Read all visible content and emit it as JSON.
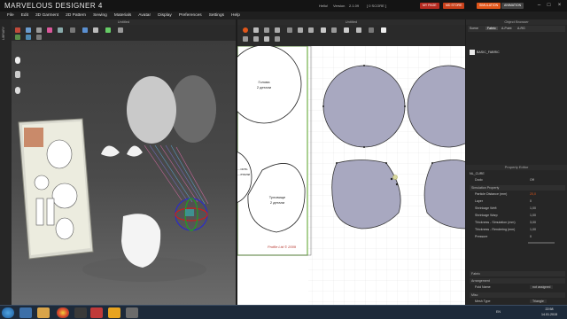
{
  "app": {
    "title": "MARVELOUS DESIGNER 4"
  },
  "titlebar": {
    "user": "Hello!",
    "version_label": "Version",
    "version": "2.1.09",
    "score_label": "[ 0 SCORE ]",
    "btn_my_page": "MY PAGE",
    "btn_md_store": "MD STORE",
    "btn_simulation": "SIMULATION",
    "btn_animation": "ANIMATION"
  },
  "menu": [
    "File",
    "Edit",
    "3D Garment",
    "2D Pattern",
    "Sewing",
    "Materials",
    "Avatar",
    "Display",
    "Preferences",
    "Settings",
    "Help"
  ],
  "left_strip": {
    "label": "LIBRARY"
  },
  "view3d": {
    "title": "Untitled"
  },
  "view2d": {
    "title": "Untitled",
    "pattern_labels": [
      {
        "name": "Голова",
        "sub": "2 детали"
      },
      {
        "name": "Туловище",
        "sub": "2 детали"
      },
      {
        "name": "...ость",
        "sub": "...етали"
      }
    ],
    "footer_text": "Profile Ltd © 2009"
  },
  "object_browser": {
    "title": "Object Browser",
    "tabs": [
      "Scene",
      "Fabric",
      "Button",
      "Buttonhole"
    ],
    "tab_labels": [
      "Scene",
      "Fabric",
      "A-Point",
      "A-RG"
    ],
    "fabric_item": "BASIC_FABRIC"
  },
  "property_editor": {
    "title": "Property Editor",
    "selected": "NL_CURE",
    "dodo_label": "Dodo",
    "dodo_value": "Off",
    "section_sim": "Simulation Property",
    "rows": [
      {
        "label": "Particle Distance (mm)",
        "value": "20,0"
      },
      {
        "label": "Layer",
        "value": "0"
      },
      {
        "label": "Shrinkage Weft",
        "value": "1,00"
      },
      {
        "label": "Shrinkage Warp",
        "value": "1,00"
      },
      {
        "label": "Thickness - Simulation (mm)",
        "value": "3,00"
      },
      {
        "label": "Thickness - Rendering (mm)",
        "value": "1,00"
      },
      {
        "label": "Pressure",
        "value": "0"
      }
    ],
    "section_fabric": "Fabric",
    "section_arrangement": "Arrangement",
    "fold_name_label": "Fold Name",
    "fold_name_value": "not assigned",
    "section_misc": "Misc",
    "mesh_type_label": "Mesh Type",
    "mesh_type_value": "Triangle"
  },
  "taskbar": {
    "time": "22:58",
    "date": "14.01.2015",
    "lang": "EN"
  },
  "colors": {
    "accent_orange": "#e0561a",
    "btn_red": "#c8321e",
    "btn_blue": "#2f6eb5",
    "pattern_fill": "#a8a8c0",
    "pattern_border_green": "#73b04a"
  }
}
